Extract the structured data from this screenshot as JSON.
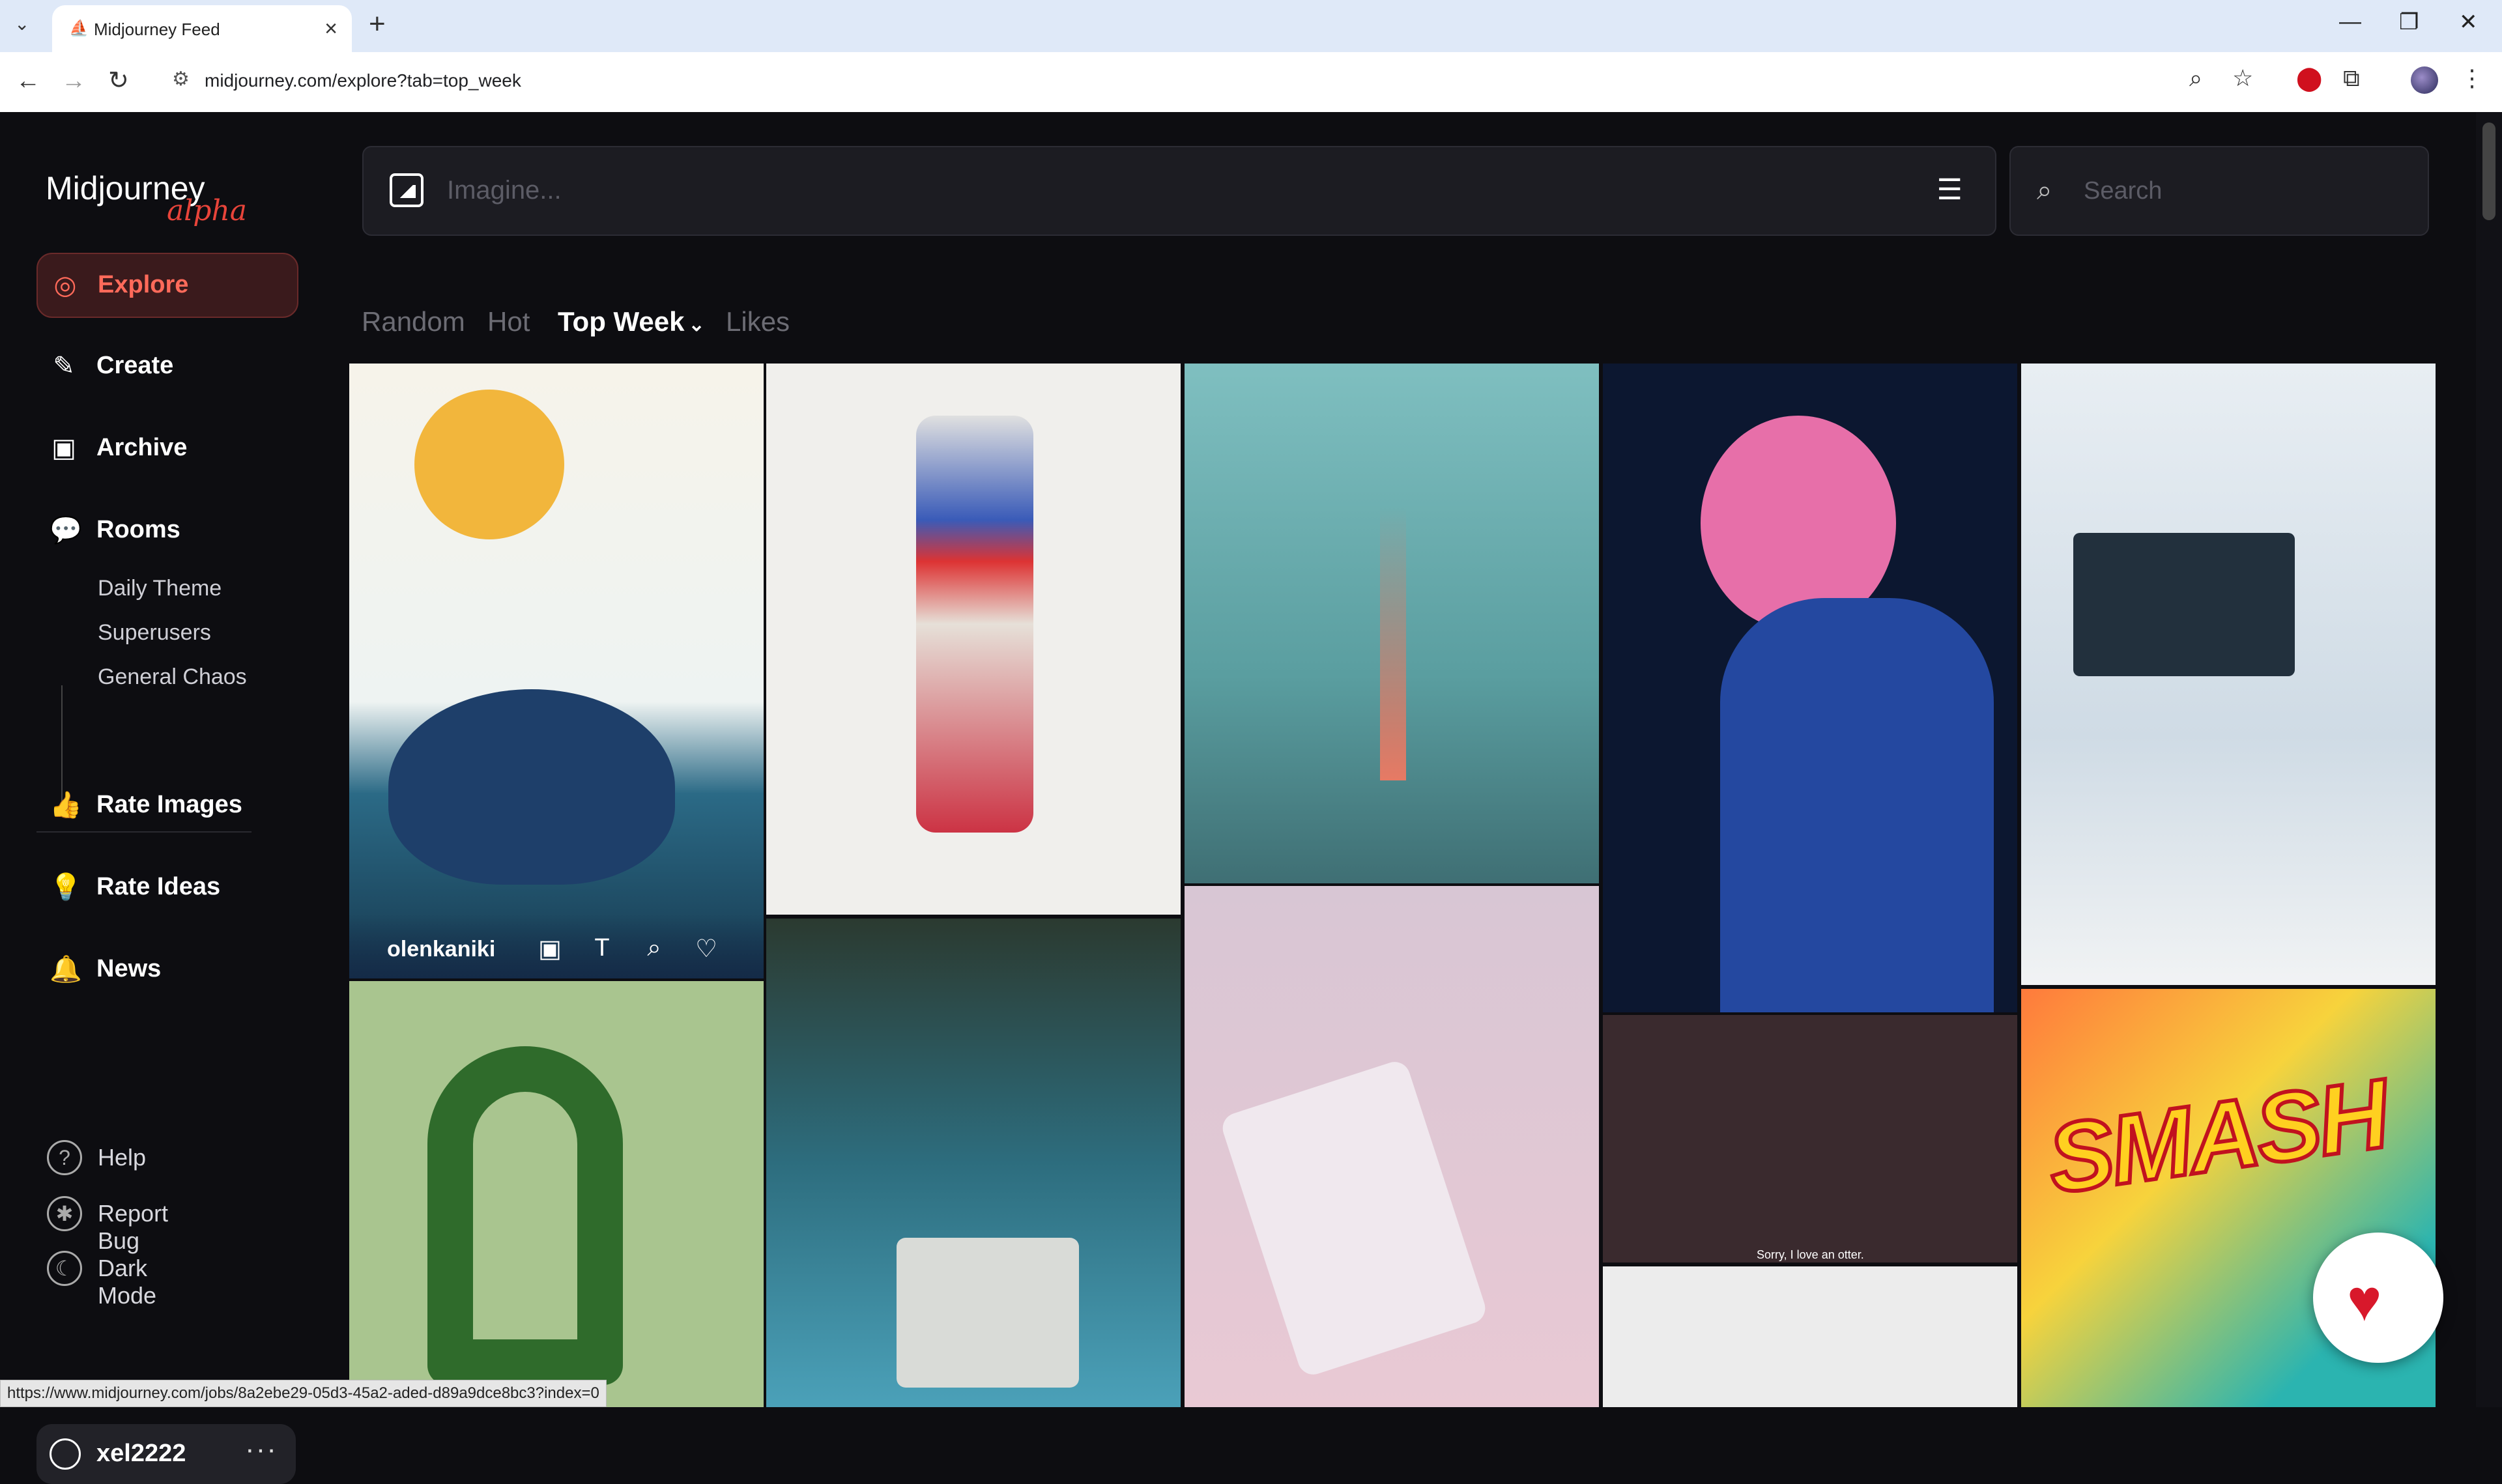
{
  "browser": {
    "tab_title": "Midjourney Feed",
    "url": "midjourney.com/explore?tab=top_week",
    "status_url": "https://www.midjourney.com/jobs/8a2ebe29-05d3-45a2-aded-d89a9dce8bc3?index=0"
  },
  "sidebar": {
    "logo": "Midjourney",
    "logo_badge": "alpha",
    "nav": {
      "explore": "Explore",
      "create": "Create",
      "archive": "Archive",
      "rooms": "Rooms",
      "rate_images": "Rate Images",
      "rate_ideas": "Rate Ideas",
      "news": "News"
    },
    "rooms": [
      "Daily Theme",
      "Superusers",
      "General Chaos"
    ],
    "footer": {
      "help": "Help",
      "report_bug": "Report Bug",
      "dark_mode": "Dark Mode"
    },
    "user": {
      "name": "xel2222",
      "more": "···"
    }
  },
  "prompt": {
    "placeholder": "Imagine...",
    "search_placeholder": "Search"
  },
  "filters": {
    "random": "Random",
    "hot": "Hot",
    "top_week": "Top Week",
    "likes": "Likes"
  },
  "feed": {
    "hover_author": "olenkaniki",
    "meme_caption": "Sorry, I love an otter.",
    "smash_text": "SMASH"
  },
  "colors": {
    "accent": "#e8443a",
    "background": "#0d0d11"
  }
}
